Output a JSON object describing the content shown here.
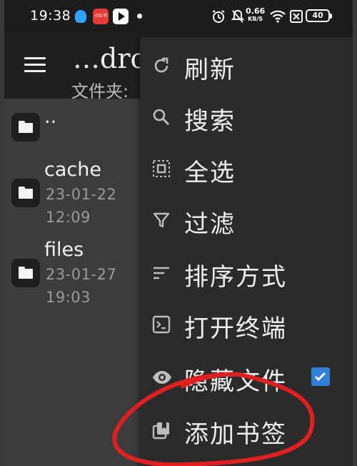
{
  "status_bar": {
    "time": "19:38",
    "red_app_text": "小红书",
    "net_speed": "0.66",
    "net_unit": "KB/S",
    "battery": "40"
  },
  "app_bar": {
    "title": "…dro",
    "subtitle": "文件夹:"
  },
  "files": [
    {
      "name": "..",
      "date": "",
      "time": ""
    },
    {
      "name": "cache",
      "date": "23-01-22",
      "time": "12:09"
    },
    {
      "name": "files",
      "date": "23-01-27",
      "time": "19:03"
    }
  ],
  "menu": {
    "items": [
      {
        "label": "刷新",
        "icon": "refresh-icon"
      },
      {
        "label": "搜索",
        "icon": "search-icon"
      },
      {
        "label": "全选",
        "icon": "select-all-icon"
      },
      {
        "label": "过滤",
        "icon": "filter-icon"
      },
      {
        "label": "排序方式",
        "icon": "sort-icon"
      },
      {
        "label": "打开终端",
        "icon": "terminal-icon"
      },
      {
        "label": "隐藏文件",
        "icon": "eye-icon",
        "checked": true
      },
      {
        "label": "添加书签",
        "icon": "bookmark-icon"
      }
    ]
  },
  "colors": {
    "checkbox": "#2f7fd8",
    "annotation": "#e02020"
  }
}
